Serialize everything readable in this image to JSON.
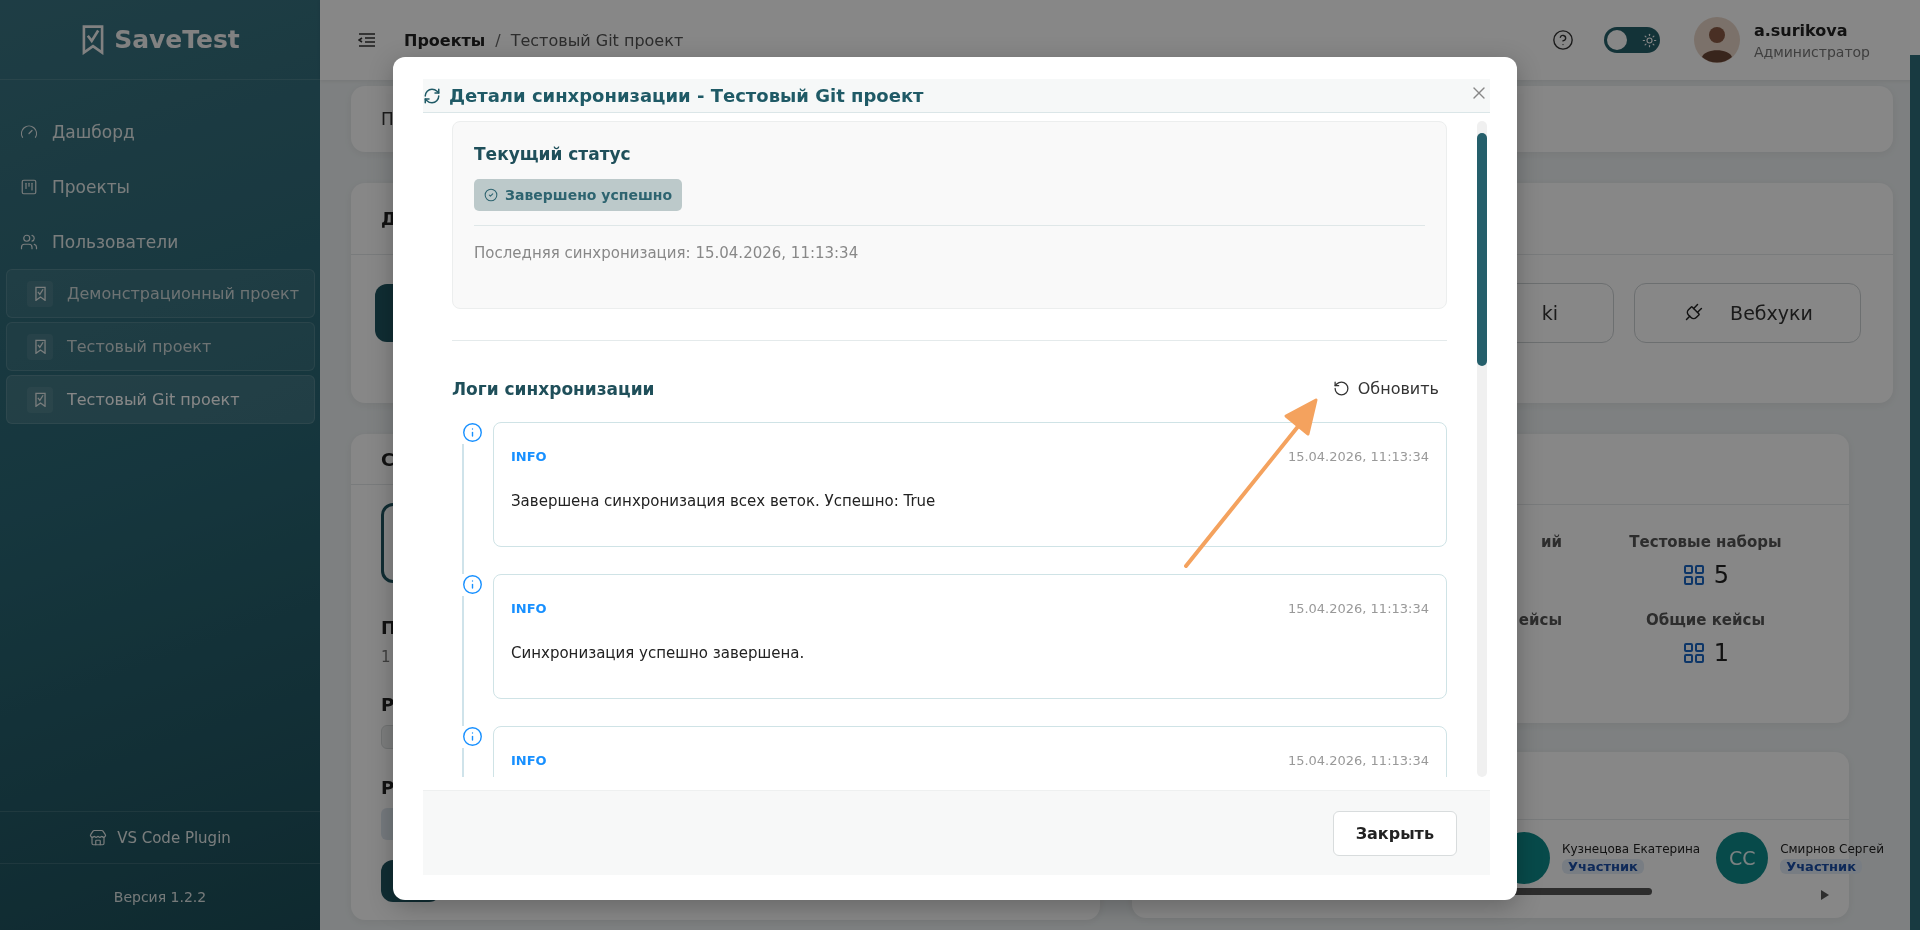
{
  "sidebar": {
    "logo": "SaveTest",
    "nav": [
      {
        "kind": "dashboard",
        "label": "Дашборд"
      },
      {
        "kind": "projects",
        "label": "Проекты"
      },
      {
        "kind": "users",
        "label": "Пользователи"
      }
    ],
    "projects": [
      {
        "label": "Демонстрационный проект",
        "selected": false
      },
      {
        "label": "Тестовый проект",
        "selected": false
      },
      {
        "label": "Тестовый Git проект",
        "selected": true
      }
    ],
    "plugin": "VS Code Plugin",
    "version": "Версия 1.2.2"
  },
  "header": {
    "breadcrumbs": [
      {
        "label": "Проекты"
      },
      {
        "label": "Тестовый Git проект"
      }
    ],
    "separator": "/",
    "dark_mode": false,
    "user": {
      "name": "a.surikova",
      "role": "Администратор"
    }
  },
  "background": {
    "card_1_text": "П",
    "card_2_title": "Д",
    "buttons": [
      "ki",
      "Вебхуки"
    ],
    "card_3": {
      "title": "С",
      "label_1": "П",
      "value_1": "1",
      "label_2": "Р",
      "label_3": "Р"
    },
    "stats": [
      {
        "label": "ий"
      },
      {
        "label": "Тестовые наборы",
        "value": "5"
      },
      {
        "label": "ейсы"
      },
      {
        "label": "Общие кейсы",
        "value": "1"
      }
    ],
    "members": [
      {
        "name": "Кузнецова Екатерина",
        "role": "Участник"
      },
      {
        "initials": "СС",
        "name": "Смирнов Сергей",
        "role": "Участник"
      }
    ]
  },
  "modal": {
    "title": "Детали синхронизации - Тестовый Git проект",
    "status": {
      "heading": "Текущий статус",
      "badge": "Завершено успешно",
      "last_sync": "Последняя синхронизация: 15.04.2026, 11:13:34"
    },
    "logs": {
      "heading": "Логи синхронизации",
      "refresh": "Обновить",
      "entries": [
        {
          "level": "INFO",
          "time": "15.04.2026, 11:13:34",
          "message": "Завершена синхронизация всех веток. Успешно: True"
        },
        {
          "level": "INFO",
          "time": "15.04.2026, 11:13:34",
          "message": "Синхронизация успешно завершена."
        },
        {
          "level": "INFO",
          "time": "15.04.2026, 11:13:34"
        }
      ]
    },
    "close": "Закрыть"
  }
}
